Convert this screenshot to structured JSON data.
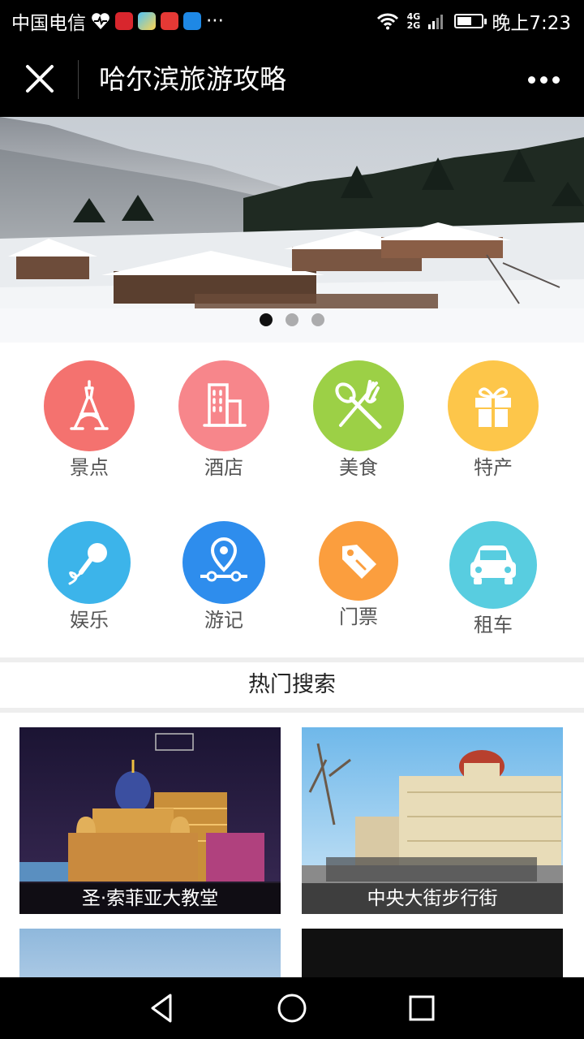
{
  "status_bar": {
    "carrier": "中国电信",
    "network_top": "4G",
    "network_bottom": "2G",
    "battery_level": 0.6,
    "time": "晚上7:23"
  },
  "nav": {
    "title": "哈尔滨旅游攻略"
  },
  "banner": {
    "slide_count": 3,
    "active_slide": 1
  },
  "categories": [
    {
      "label": "景点",
      "icon": "tower-icon",
      "color": "#f4726f"
    },
    {
      "label": "酒店",
      "icon": "building-icon",
      "color": "#f7868b"
    },
    {
      "label": "美食",
      "icon": "fork-spoon-icon",
      "color": "#9cd046"
    },
    {
      "label": "特产",
      "icon": "gift-icon",
      "color": "#fdc64a"
    },
    {
      "label": "娱乐",
      "icon": "microphone-icon",
      "color": "#3cb4ea"
    },
    {
      "label": "游记",
      "icon": "location-route-icon",
      "color": "#2e8ded"
    },
    {
      "label": "门票",
      "icon": "ticket-tag-icon",
      "color": "#fb9e3e"
    },
    {
      "label": "租车",
      "icon": "car-icon",
      "color": "#58cde0"
    }
  ],
  "hot_search": {
    "title": "热门搜索",
    "cards": [
      {
        "caption": "圣·索菲亚大教堂"
      },
      {
        "caption": "中央大街步行街"
      }
    ]
  },
  "colors": {
    "bar_background": "#000000",
    "divider": "#eeeeee"
  }
}
